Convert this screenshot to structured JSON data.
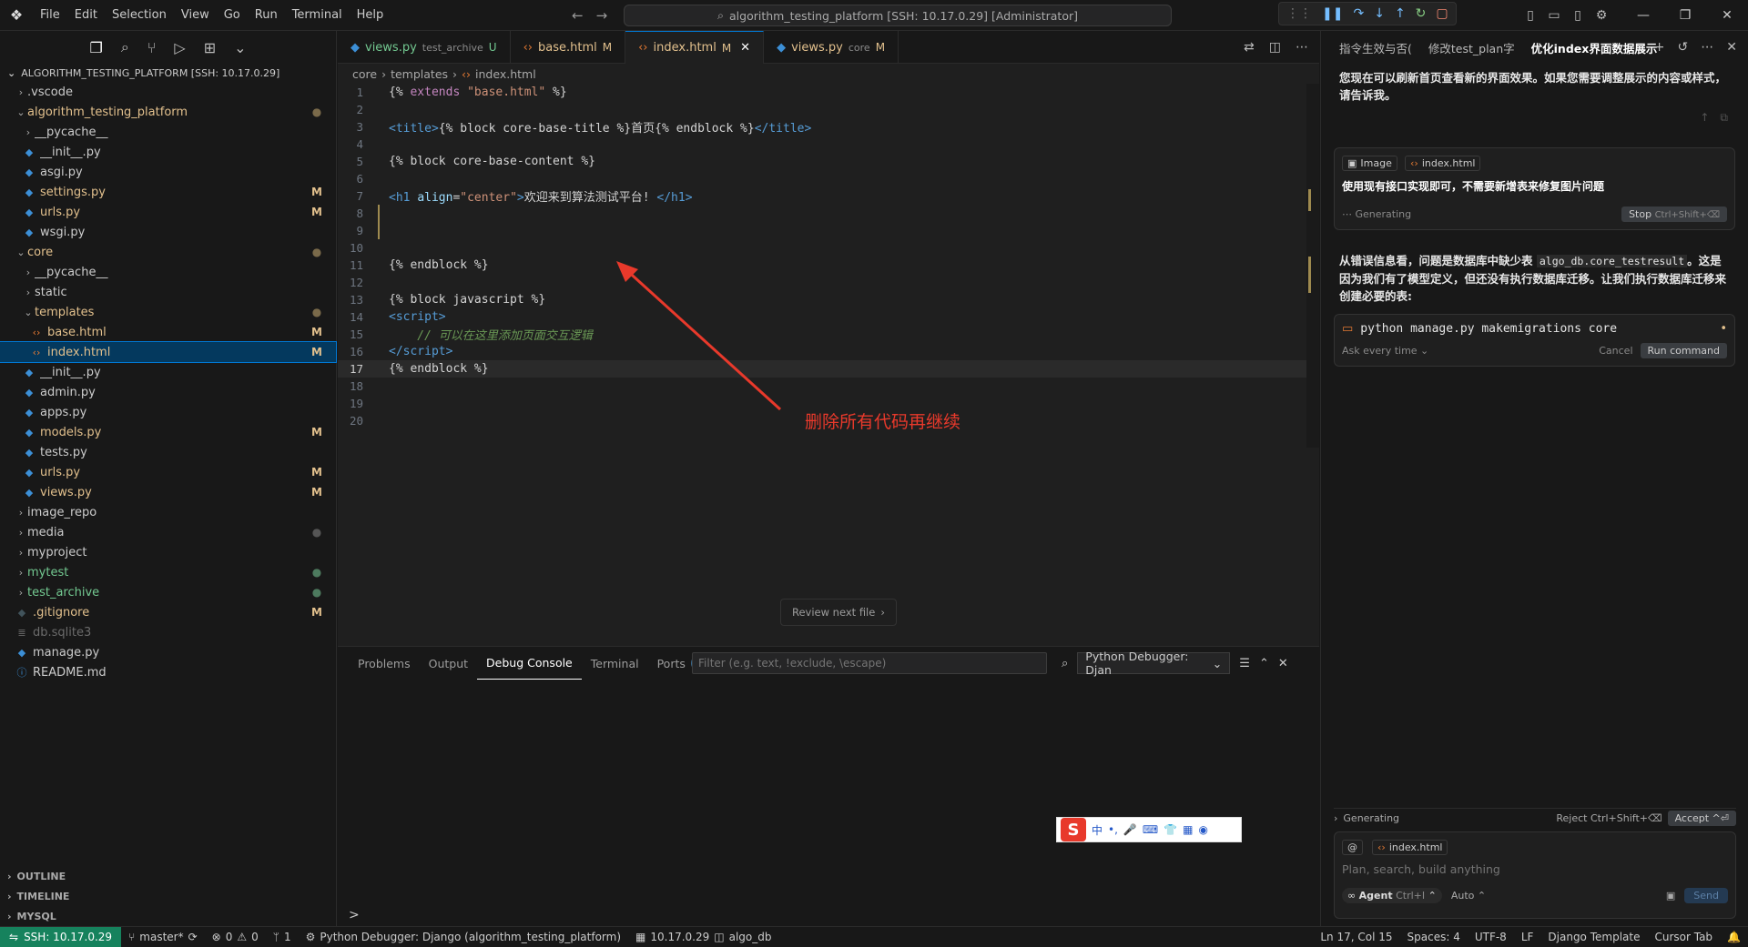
{
  "menu": [
    "File",
    "Edit",
    "Selection",
    "View",
    "Go",
    "Run",
    "Terminal",
    "Help"
  ],
  "command_center": "algorithm_testing_platform [SSH: 10.17.0.29] [Administrator]",
  "explorer": {
    "title": "ALGORITHM_TESTING_PLATFORM [SSH: 10.17.0.29]",
    "items": [
      {
        "label": ".vscode",
        "badge": ""
      },
      {
        "label": "algorithm_testing_platform",
        "badge": "●"
      },
      {
        "label": "__pycache__",
        "badge": ""
      },
      {
        "label": "__init__.py",
        "badge": ""
      },
      {
        "label": "asgi.py",
        "badge": ""
      },
      {
        "label": "settings.py",
        "badge": "M"
      },
      {
        "label": "urls.py",
        "badge": "M"
      },
      {
        "label": "wsgi.py",
        "badge": ""
      },
      {
        "label": "core",
        "badge": "●"
      },
      {
        "label": "__pycache__",
        "badge": ""
      },
      {
        "label": "static",
        "badge": ""
      },
      {
        "label": "templates",
        "badge": "●"
      },
      {
        "label": "base.html",
        "badge": "M"
      },
      {
        "label": "index.html",
        "badge": "M"
      },
      {
        "label": "__init__.py",
        "badge": ""
      },
      {
        "label": "admin.py",
        "badge": ""
      },
      {
        "label": "apps.py",
        "badge": ""
      },
      {
        "label": "models.py",
        "badge": "M"
      },
      {
        "label": "tests.py",
        "badge": ""
      },
      {
        "label": "urls.py",
        "badge": "M"
      },
      {
        "label": "views.py",
        "badge": "M"
      },
      {
        "label": "image_repo",
        "badge": ""
      },
      {
        "label": "media",
        "badge": "●"
      },
      {
        "label": "myproject",
        "badge": ""
      },
      {
        "label": "mytest",
        "badge": "●"
      },
      {
        "label": "test_archive",
        "badge": "●"
      },
      {
        "label": ".gitignore",
        "badge": "M"
      },
      {
        "label": "db.sqlite3",
        "badge": ""
      },
      {
        "label": "manage.py",
        "badge": ""
      },
      {
        "label": "README.md",
        "badge": ""
      }
    ],
    "bottom": [
      "OUTLINE",
      "TIMELINE",
      "MYSQL"
    ]
  },
  "tabs": [
    {
      "name": "views.py",
      "sub": "test_archive",
      "flag": "U"
    },
    {
      "name": "base.html",
      "sub": "",
      "flag": "M"
    },
    {
      "name": "index.html",
      "sub": "",
      "flag": "M"
    },
    {
      "name": "views.py",
      "sub": "core",
      "flag": "M"
    }
  ],
  "breadcrumb": [
    "core",
    "templates",
    "index.html"
  ],
  "code_lines": {
    "n": [
      "1",
      "2",
      "3",
      "4",
      "5",
      "6",
      "7",
      "8",
      "9",
      "10",
      "11",
      "12",
      "13",
      "14",
      "15",
      "16",
      "17",
      "18",
      "19",
      "20"
    ]
  },
  "annotation": "删除所有代码再继续",
  "review_next": "Review next file",
  "panel": {
    "tabs": [
      "Problems",
      "Output",
      "Debug Console",
      "Terminal",
      "Ports"
    ],
    "ports_count": "1",
    "filter_placeholder": "Filter (e.g. text, !exclude, \\escape)",
    "debugger": "Python Debugger: Djan",
    "prompt": ">"
  },
  "ime": {
    "chinese": "中"
  },
  "chat": {
    "tabs": [
      "指令生效与否(",
      "修改test_plan字",
      "优化index界面数据展示"
    ],
    "msg1": "您现在可以刷新首页查看新的界面效果。如果您需要调整展示的内容或样式，请告诉我。",
    "chip_image": "Image",
    "chip_file": "index.html",
    "user_msg": "使用现有接口实现即可，不需要新增表来修复图片问题",
    "generating": "Generating",
    "stop": "Stop",
    "stop_key": "Ctrl+Shift+⌫",
    "msg2a": "从错误信息看，问题是数据库中缺少表",
    "msg2_code": "algo_db.core_testresult",
    "msg2b": "。这是因为我们有了模型定义，但还没有执行数据库迁移。让我们执行数据库迁移来创建必要的表:",
    "command": "python manage.py makemigrations core",
    "ask": "Ask every time",
    "cancel": "Cancel",
    "run": "Run command",
    "gen2": "Generating",
    "reject": "Reject Ctrl+Shift+⌫",
    "accept": "Accept",
    "ctx_file": "index.html",
    "placeholder": "Plan, search, build anything",
    "agent": "Agent",
    "agent_key": "Ctrl+I",
    "auto": "Auto",
    "send": "Send"
  },
  "status": {
    "remote": "SSH: 10.17.0.29",
    "branch": "master*",
    "errors": "0",
    "warnings": "0",
    "ports": "1",
    "debug": "Python Debugger: Django (algorithm_testing_platform)",
    "host": "10.17.0.29",
    "db": "algo_db",
    "pos": "Ln 17, Col 15",
    "spaces": "Spaces: 4",
    "enc": "UTF-8",
    "eol": "LF",
    "lang": "Django Template",
    "tab": "Cursor Tab"
  }
}
